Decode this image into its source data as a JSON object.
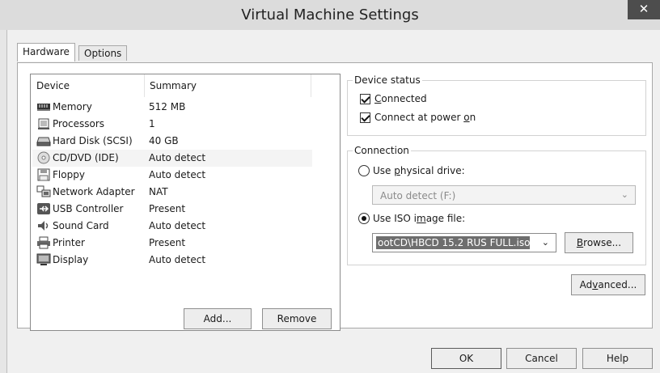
{
  "window": {
    "title": "Virtual Machine Settings",
    "close_glyph": "✕"
  },
  "tabs": [
    {
      "label": "Hardware",
      "active": true
    },
    {
      "label": "Options",
      "active": false
    }
  ],
  "device_list": {
    "columns": [
      "Device",
      "Summary"
    ],
    "rows": [
      {
        "device": "Memory",
        "summary": "512 MB",
        "icon": "memory-icon"
      },
      {
        "device": "Processors",
        "summary": "1",
        "icon": "processor-icon"
      },
      {
        "device": "Hard Disk (SCSI)",
        "summary": "40 GB",
        "icon": "hard-disk-icon"
      },
      {
        "device": "CD/DVD (IDE)",
        "summary": "Auto detect",
        "icon": "cd-dvd-icon",
        "selected": true
      },
      {
        "device": "Floppy",
        "summary": "Auto detect",
        "icon": "floppy-icon"
      },
      {
        "device": "Network Adapter",
        "summary": "NAT",
        "icon": "network-adapter-icon"
      },
      {
        "device": "USB Controller",
        "summary": "Present",
        "icon": "usb-controller-icon"
      },
      {
        "device": "Sound Card",
        "summary": "Auto detect",
        "icon": "sound-card-icon"
      },
      {
        "device": "Printer",
        "summary": "Present",
        "icon": "printer-icon"
      },
      {
        "device": "Display",
        "summary": "Auto detect",
        "icon": "display-icon"
      }
    ]
  },
  "list_buttons": {
    "add": "Add...",
    "remove": "Remove"
  },
  "device_status": {
    "title": "Device status",
    "connected": {
      "pre": "",
      "key": "C",
      "post": "onnected",
      "checked": true
    },
    "connect_power": {
      "pre": "Connect at power ",
      "key": "o",
      "post": "n",
      "checked": true
    }
  },
  "connection": {
    "title": "Connection",
    "physical": {
      "pre": "Use ",
      "key": "p",
      "post": "hysical drive:",
      "selected": false
    },
    "physical_value": "Auto detect (F:)",
    "iso": {
      "pre": "Use ISO i",
      "key": "m",
      "post": "age file:",
      "selected": true
    },
    "iso_value": "ootCD\\HBCD 15.2 RUS FULL.iso",
    "browse": {
      "pre": "",
      "key": "B",
      "post": "rowse..."
    }
  },
  "advanced": {
    "pre": "Ad",
    "key": "v",
    "post": "anced..."
  },
  "footer": {
    "ok": "OK",
    "cancel": "Cancel",
    "help": "Help"
  }
}
